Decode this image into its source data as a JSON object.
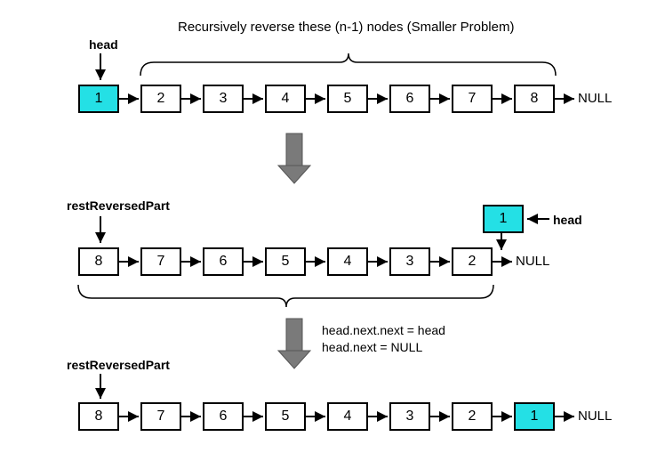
{
  "caption_top": "Recursively reverse these (n-1) nodes (Smaller Problem)",
  "labels": {
    "head": "head",
    "restReversedPart": "restReversedPart",
    "null": "NULL"
  },
  "code": {
    "line1": "head.next.next = head",
    "line2": "head.next = NULL"
  },
  "chart_data": {
    "type": "diagram",
    "title": "Recursive reversal of a singly linked list",
    "steps": [
      {
        "name": "initial",
        "head_label": "head",
        "head_points_to_index": 0,
        "highlighted_index": 0,
        "nodes": [
          1,
          2,
          3,
          4,
          5,
          6,
          7,
          8
        ],
        "terminal": "NULL",
        "brace_over_indices": [
          1,
          7
        ],
        "brace_caption": "Recursively reverse these (n-1) nodes (Smaller Problem)"
      },
      {
        "name": "after_recursive_reverse",
        "restReversedPart_label": "restReversedPart",
        "rest_points_to_index": 0,
        "head_label": "head",
        "head_dangling_value": 1,
        "head_dangling_points_to_index": 6,
        "highlighted_dangling": true,
        "nodes": [
          8,
          7,
          6,
          5,
          4,
          3,
          2
        ],
        "terminal": "NULL",
        "brace_under_indices": [
          0,
          6
        ]
      },
      {
        "name": "after_fixup",
        "operations": [
          "head.next.next = head",
          "head.next = NULL"
        ],
        "restReversedPart_label": "restReversedPart",
        "rest_points_to_index": 0,
        "highlighted_index": 7,
        "nodes": [
          8,
          7,
          6,
          5,
          4,
          3,
          2,
          1
        ],
        "terminal": "NULL"
      }
    ]
  }
}
